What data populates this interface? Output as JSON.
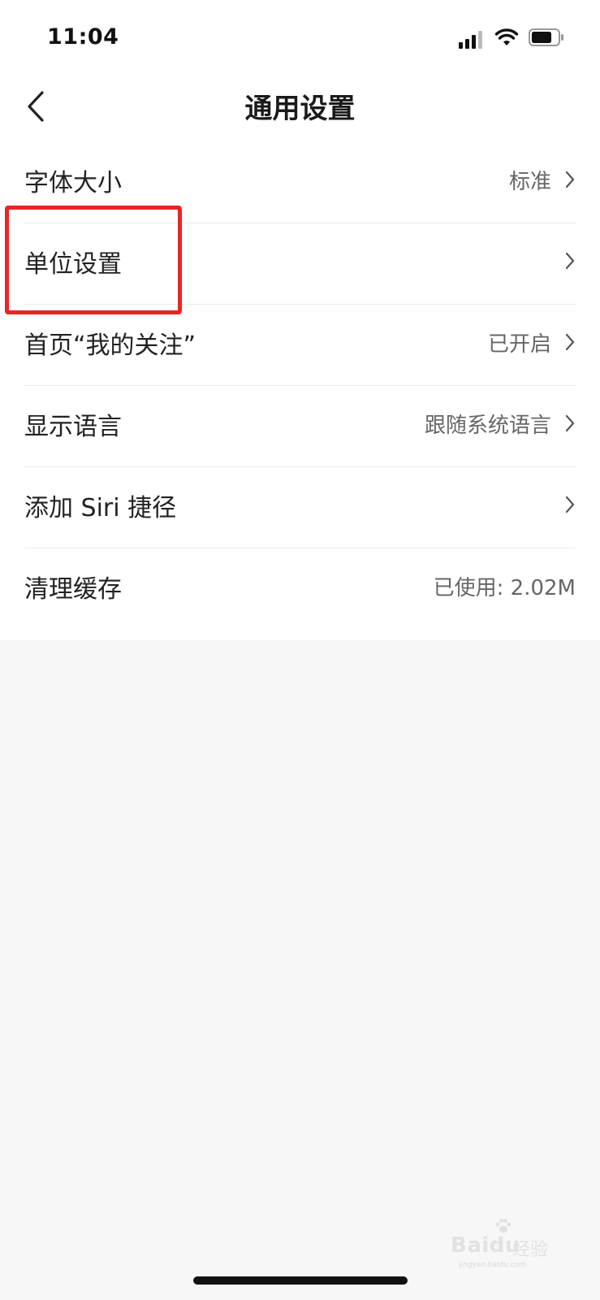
{
  "status_bar": {
    "time": "11:04",
    "icons": [
      "signal-icon",
      "wifi-icon",
      "battery-icon"
    ]
  },
  "nav": {
    "title": "通用设置",
    "back_icon": "chevron-left-icon"
  },
  "settings": [
    {
      "label": "字体大小",
      "value": "标准",
      "chevron": true
    },
    {
      "label": "单位设置",
      "value": "",
      "chevron": true
    },
    {
      "label": "首页“我的关注”",
      "value": "已开启",
      "chevron": true
    },
    {
      "label": "显示语言",
      "value": "跟随系统语言",
      "chevron": true
    },
    {
      "label": "添加 Siri 捷径",
      "value": "",
      "chevron": true
    },
    {
      "label": "清理缓存",
      "value": "已使用: 2.02M",
      "chevron": false
    }
  ],
  "highlight": {
    "target": "单位设置",
    "color": "#ea2525"
  },
  "watermark": {
    "brand": "Baidu",
    "sub": "经验",
    "url": "jingyan.baidu.com"
  },
  "colors": {
    "background": "#f7f7f7",
    "card": "#ffffff",
    "divider": "#ececec",
    "secondary_text": "#666666"
  }
}
